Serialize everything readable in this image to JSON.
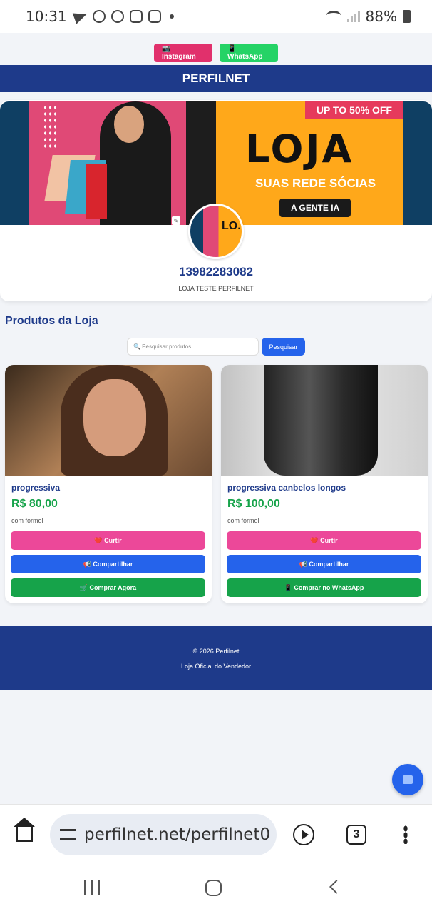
{
  "status_bar": {
    "time": "10:31",
    "battery": "88%"
  },
  "social": {
    "instagram_label": "📷 Instagram",
    "whatsapp_label": "📱 WhatsApp"
  },
  "header": {
    "brand": "PERFILNET"
  },
  "banner": {
    "promo": "UP TO 50% OFF",
    "title": "LOJA",
    "subtitle": "SUAS REDE SÓCIAS",
    "pill": "A GENTE  IA",
    "avatar_text": "LO."
  },
  "profile": {
    "phone": "13982283082",
    "store_name": "LOJA TESTE PERFILNET"
  },
  "products_section": {
    "title": "Produtos da Loja",
    "search_placeholder": "🔍 Pesquisar produtos...",
    "search_button": "Pesquisar"
  },
  "products": [
    {
      "name": "progressiva",
      "price": "R$ 80,00",
      "description": "com formol",
      "like_label": "❤️ Curtir",
      "share_label": "📢 Compartilhar",
      "buy_label": "🛒 Comprar Agora"
    },
    {
      "name": "progressiva canbelos longos",
      "price": "R$ 100,00",
      "description": "com formol",
      "like_label": "❤️ Curtir",
      "share_label": "📢 Compartilhar",
      "buy_label": "📱 Comprar no WhatsApp"
    }
  ],
  "footer": {
    "copyright": "© 2026 Perfilnet",
    "tagline": "Loja Oficial do Vendedor"
  },
  "browser": {
    "url": "perfilnet.net/perfilnet0",
    "tab_count": "3"
  },
  "colors": {
    "brand": "#1e3a8a",
    "like": "#ec4899",
    "share": "#2563eb",
    "buy": "#16a34a",
    "price": "#16a34a",
    "instagram": "#e1306c",
    "whatsapp": "#25d366"
  }
}
